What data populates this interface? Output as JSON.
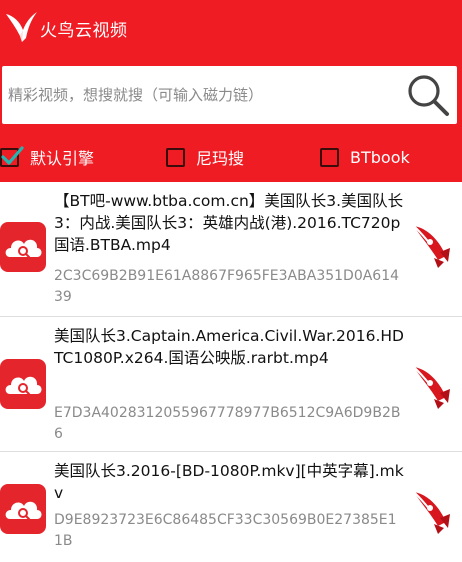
{
  "app": {
    "title": "火鸟云视频"
  },
  "search": {
    "placeholder": "精彩视频，想搜就搜（可输入磁力链）",
    "value": ""
  },
  "engines": [
    {
      "label": "默认引擎",
      "checked": true
    },
    {
      "label": "尼玛搜",
      "checked": false
    },
    {
      "label": "BTbook",
      "checked": false
    }
  ],
  "results": [
    {
      "title": "【BT吧-www.btba.com.cn】美国队长3.美国队长3：内战.美国队长3：英雄内战(港).2016.TC720p国语.BTBA.mp4",
      "hash": "2C3C69B2B91E61A8867F965FE3ABA351D0A61439"
    },
    {
      "title": "美国队长3.Captain.America.Civil.War.2016.HDTC1080P.x264.国语公映版.rarbt.mp4",
      "hash": "E7D3A4028312055967778977B6512C9A6D9B2B6"
    },
    {
      "title": "美国队长3.2016-[BD-1080P.mkv][中英字幕].mkv",
      "hash": "D9E8923723E6C86485CF33C30569B0E27385E11B"
    }
  ],
  "colors": {
    "accent": "#f01c24",
    "hash_text": "#8a8a8a"
  },
  "icons": {
    "logo": "bird-logo-icon",
    "search": "search-icon",
    "item": "cloud-search-icon",
    "download": "rocket-icon"
  }
}
